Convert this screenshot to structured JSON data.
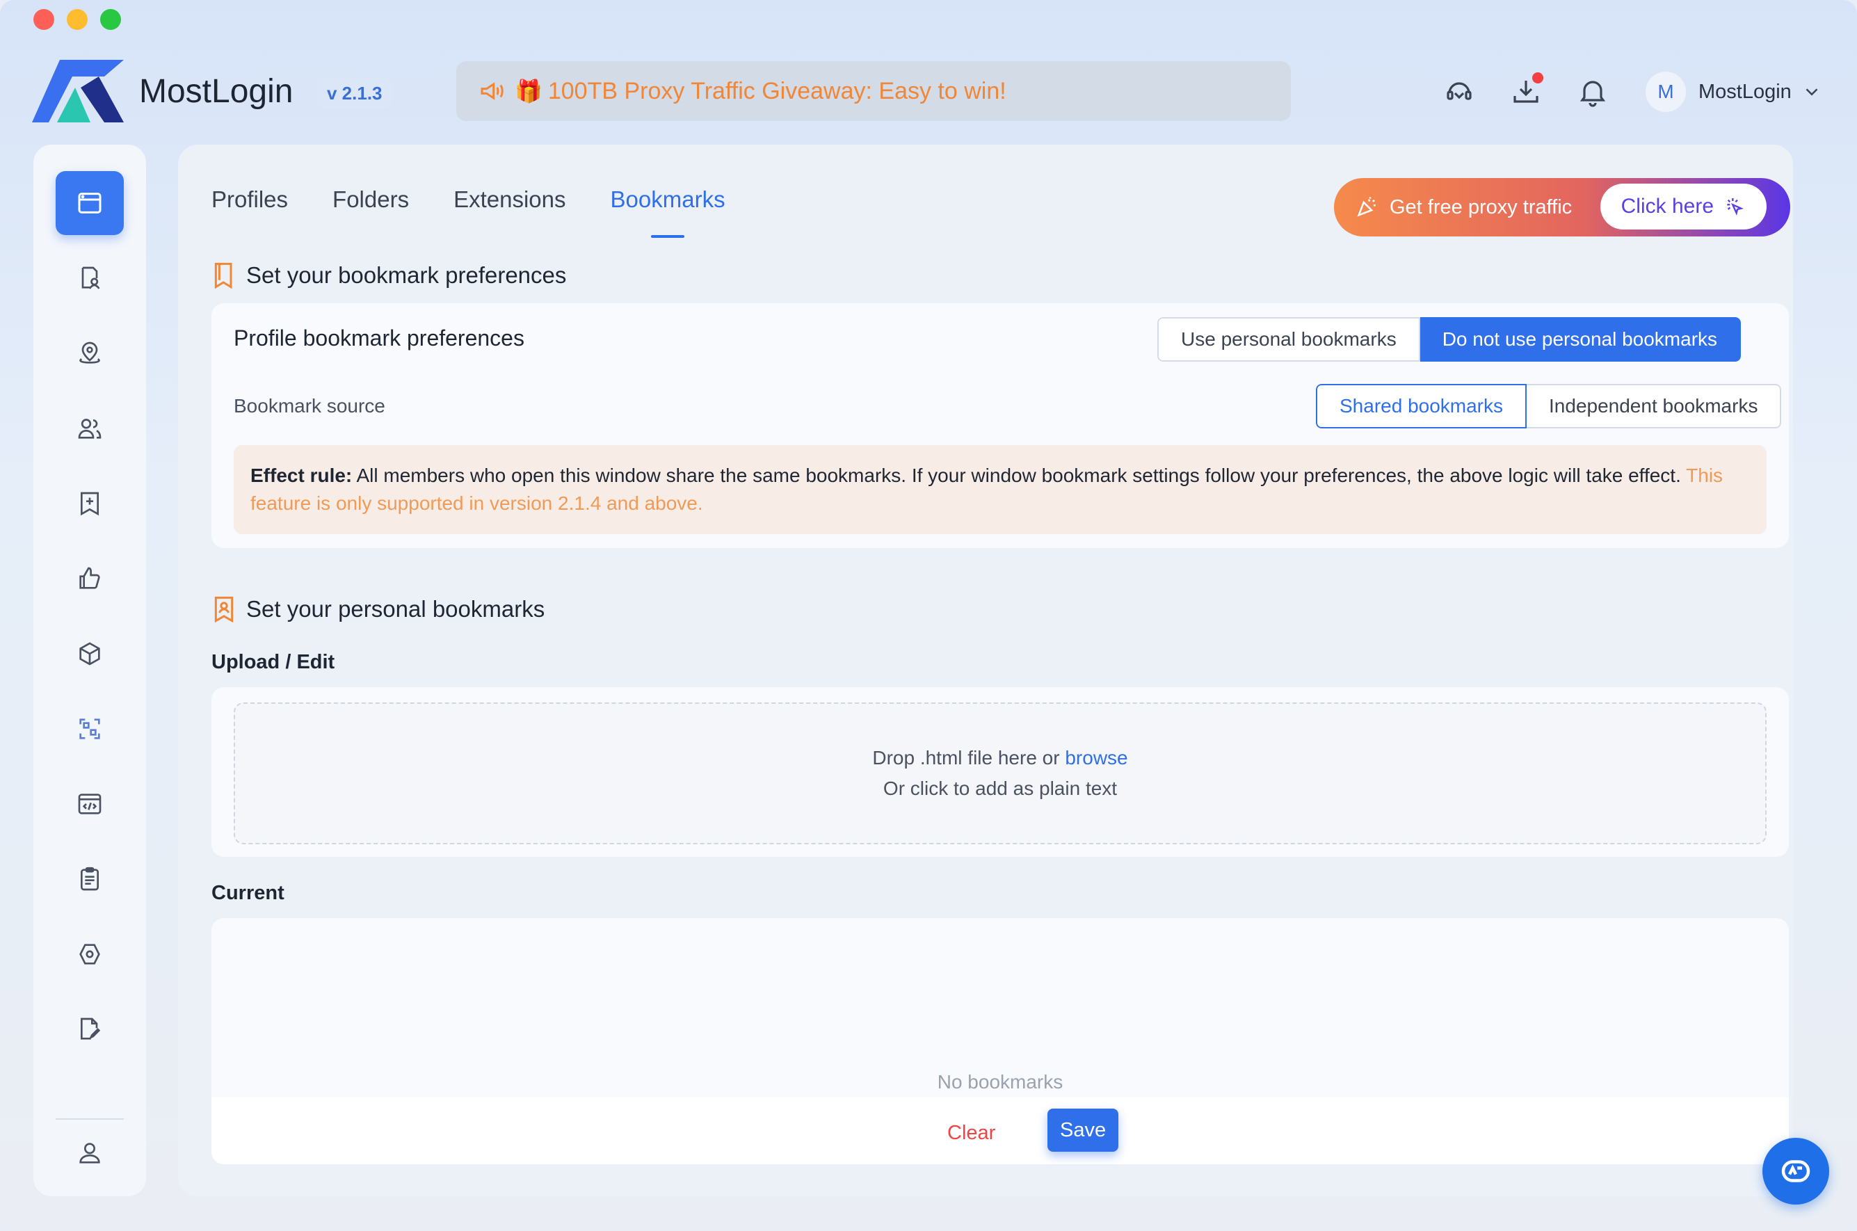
{
  "app": {
    "name": "MostLogin",
    "version": "v 2.1.3",
    "announcement": "100TB Proxy Traffic Giveaway: Easy to win!",
    "user": {
      "initial": "M",
      "name": "MostLogin"
    }
  },
  "colors": {
    "accent": "#2f6fea",
    "warning": "#f08636",
    "danger": "#ef4444"
  },
  "header_icons": [
    "support-icon",
    "download-icon",
    "bell-icon"
  ],
  "sidebar": {
    "items": [
      {
        "icon": "browser-window-icon",
        "active": true
      },
      {
        "icon": "profile-doc-icon"
      },
      {
        "icon": "location-pin-icon"
      },
      {
        "icon": "team-icon"
      },
      {
        "icon": "bookmark-plus-icon"
      },
      {
        "icon": "thumbs-up-icon"
      },
      {
        "icon": "cube-icon"
      },
      {
        "icon": "layout-grid-icon"
      },
      {
        "icon": "code-window-icon"
      },
      {
        "icon": "clipboard-icon"
      },
      {
        "icon": "settings-hex-icon"
      },
      {
        "icon": "edit-doc-icon"
      }
    ],
    "bottom": {
      "icon": "user-icon"
    }
  },
  "tabs": [
    {
      "label": "Profiles"
    },
    {
      "label": "Folders"
    },
    {
      "label": "Extensions"
    },
    {
      "label": "Bookmarks",
      "active": true
    }
  ],
  "promo": {
    "text": "Get free proxy traffic",
    "button": "Click here"
  },
  "preferences": {
    "section_title": "Set your bookmark preferences",
    "label": "Profile bookmark preferences",
    "options": [
      "Use personal bookmarks",
      "Do not use personal bookmarks"
    ],
    "selected": "Do not use personal bookmarks",
    "source_label": "Bookmark source",
    "source_options": [
      "Shared bookmarks",
      "Independent bookmarks"
    ],
    "source_selected": "Shared bookmarks",
    "rule_title": "Effect rule:",
    "rule_text": " All members who open this window share the same bookmarks. If your window bookmark settings follow your preferences, the above logic will take effect.",
    "rule_warning": " This feature is only supported in version 2.1.4 and above."
  },
  "personal": {
    "section_title": "Set your personal bookmarks",
    "upload_label": "Upload / Edit",
    "drop_text": "Drop .html file here or",
    "drop_link": "browse",
    "drop_sub": "Or click to add as plain text",
    "current_label": "Current",
    "empty_text": "No bookmarks",
    "clear_label": "Clear",
    "save_label": "Save"
  }
}
